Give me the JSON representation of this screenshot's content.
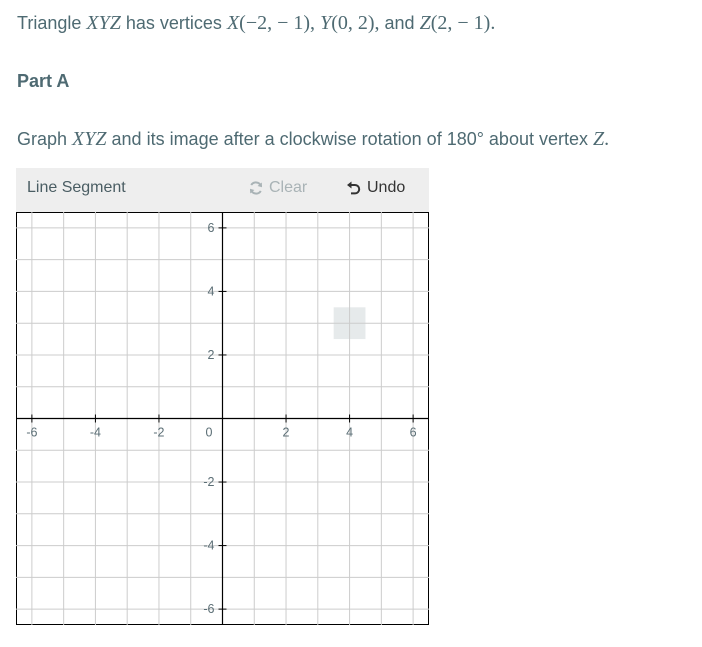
{
  "question": {
    "prefix": "Triangle",
    "triangle_name": "XYZ",
    "middle": "has vertices",
    "vertices": [
      {
        "name": "X",
        "coords": "(−2,  − 1)"
      },
      {
        "name": "Y",
        "coords": "(0,  2)"
      },
      {
        "name": "Z",
        "coords": "(2,  − 1)"
      }
    ],
    "and_word": "and",
    "end": "."
  },
  "part_a": {
    "heading": "Part A",
    "instruction_prefix": "Graph",
    "instruction_name": "XYZ",
    "instruction_middle": "and its image after a clockwise rotation of 180° about vertex",
    "instruction_vertex": "Z",
    "instruction_end": "."
  },
  "toolbar": {
    "tool_label": "Line Segment",
    "clear_label": "Clear",
    "undo_label": "Undo",
    "clear_icon": "refresh-icon",
    "undo_icon": "undo-icon"
  },
  "graph": {
    "xlim": [
      -6.5,
      6.5
    ],
    "ylim": [
      -6.5,
      6.5
    ],
    "grid_step": 1,
    "x_ticks": [
      -6,
      -4,
      -2,
      2,
      4,
      6
    ],
    "y_ticks": [
      6,
      4,
      2,
      -2,
      -4,
      -6
    ],
    "origin_label": "0",
    "hover_cell_center": [
      4,
      3
    ],
    "colors": {
      "grid": "#cccccc",
      "axis": "#000000",
      "highlight": "#e6eaeb"
    }
  }
}
